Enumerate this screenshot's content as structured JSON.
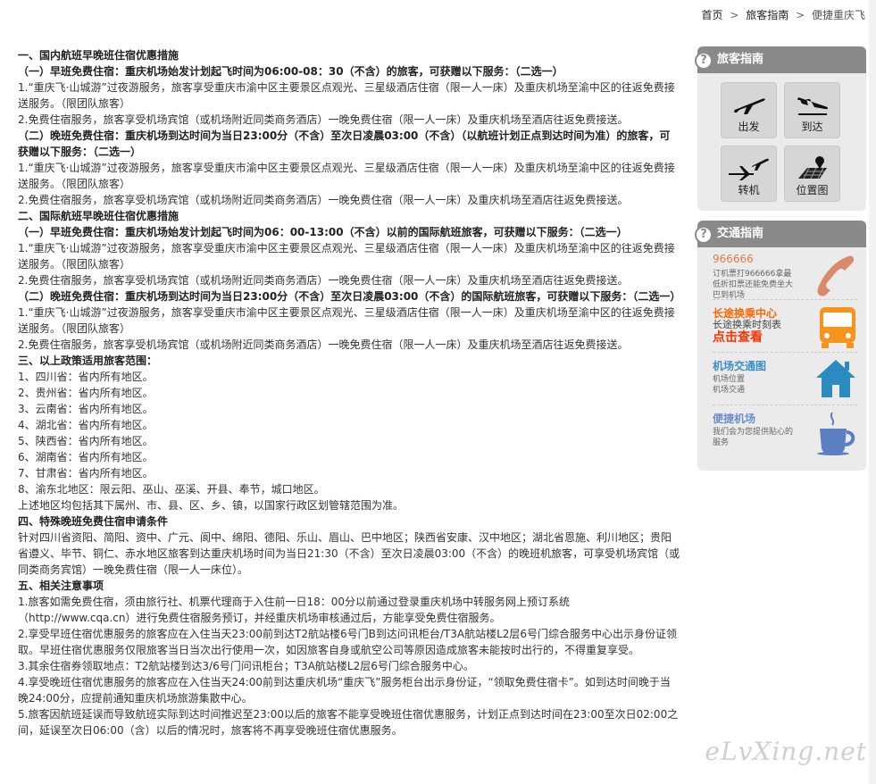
{
  "breadcrumb": {
    "items": [
      "首页",
      "旅客指南",
      "便捷重庆飞"
    ],
    "separator": ">"
  },
  "content": {
    "lines": [
      {
        "text": "一、国内航班早晚班住宿优惠措施",
        "bold": true
      },
      {
        "text": "（一）早班免费住宿：重庆机场始发计划起飞时间为06:00-08：30（不含）的旅客，可获赠以下服务：（二选一）",
        "bold": true
      },
      {
        "text": "1.“重庆飞·山城游”过夜游服务，旅客享受重庆市渝中区主要景区点观光、三星级酒店住宿（限一人一床）及重庆机场至渝中区的往返免费接送服务。（限团队旅客）",
        "bold": false
      },
      {
        "text": "2.免费住宿服务，旅客享受机场宾馆（或机场附近同类商务酒店）一晚免费住宿（限一人一床）及重庆机场至酒店往返免费接送。",
        "bold": false
      },
      {
        "text": "（二）晚班免费住宿：重庆机场到达时间为当日23:00分（不含）至次日凌晨03:00（不含）（以航班计划正点到达时间为准）的旅客，可获赠以下服务：（二选一）",
        "bold": true
      },
      {
        "text": "1.“重庆飞·山城游”过夜游服务，旅客享受重庆市渝中区主要景区点观光、三星级酒店住宿（限一人一床）及重庆机场至渝中区的往返免费接送服务。（限团队旅客）",
        "bold": false
      },
      {
        "text": "2.免费住宿服务，旅客享受机场宾馆（或机场附近同类商务酒店）一晚免费住宿（限一人一床）及重庆机场至酒店往返免费接送。",
        "bold": false
      },
      {
        "text": "二、国际航班早晚班住宿优惠措施",
        "bold": true
      },
      {
        "text": "（一）早班免费住宿：重庆机场始发计划起飞时间为06：00-13:00（不含）以前的国际航班旅客，可获赠以下服务：（二选一）",
        "bold": true
      },
      {
        "text": "1.“重庆飞·山城游”过夜游服务，旅客享受重庆市渝中区主要景区点观光、三星级酒店住宿（限一人一床）及重庆机场至渝中区的往返免费接送服务。（限团队旅客）",
        "bold": false
      },
      {
        "text": "2.免费住宿服务，旅客享受机场宾馆（或机场附近同类商务酒店）一晚免费住宿（限一人一床）及重庆机场至酒店往返免费接送。",
        "bold": false
      },
      {
        "text": "（二）晚班免费住宿：重庆机场到达时间为当日23:00分（不含）至次日凌晨03:00（不含）的国际航班旅客，可获赠以下服务：（二选一）",
        "bold": true
      },
      {
        "text": "1.“重庆飞·山城游”过夜游服务，旅客享受重庆市渝中区主要景区点观光、三星级酒店住宿（限一人一床）及重庆机场至渝中区的往返免费接送服务。（限团队旅客）",
        "bold": false
      },
      {
        "text": "2.免费住宿服务，旅客享受机场宾馆（或机场附近同类商务酒店）一晚免费住宿（限一人一床）及重庆机场至酒店往返免费接送。",
        "bold": false
      },
      {
        "text": "三、以上政策适用旅客范围：",
        "bold": true
      },
      {
        "text": "1、四川省：省内所有地区。",
        "bold": false
      },
      {
        "text": "2、贵州省：省内所有地区。",
        "bold": false
      },
      {
        "text": "3、云南省：省内所有地区。",
        "bold": false
      },
      {
        "text": "4、湖北省：省内所有地区。",
        "bold": false
      },
      {
        "text": "5、陕西省：省内所有地区。",
        "bold": false
      },
      {
        "text": "6、湖南省：省内所有地区。",
        "bold": false
      },
      {
        "text": "7、甘肃省：省内所有地区。",
        "bold": false
      },
      {
        "text": "8、渝东北地区：限云阳、巫山、巫溪、开县、奉节，城口地区。",
        "bold": false
      },
      {
        "text": "上述地区均包括其下属州、市、县、区、乡、镇，以国家行政区划管辖范围为准。",
        "bold": false
      },
      {
        "text": "四、特殊晚班免费住宿申请条件",
        "bold": true
      },
      {
        "text": "针对四川省资阳、简阳、资中、广元、阆中、绵阳、德阳、乐山、眉山、巴中地区；陕西省安康、汉中地区；湖北省恩施、利川地区；贵阳省遵义、毕节、铜仁、赤水地区旅客到达重庆机场时间为当日21:30（不含）至次日凌晨03:00（不含）的晚班机旅客，可享受机场宾馆（或同类商务宾馆）一晚免费住宿（限一人一床位）。",
        "bold": false
      },
      {
        "text": "五、相关注意事项",
        "bold": true
      },
      {
        "text": "1.旅客如需免费住宿，须由旅行社、机票代理商于入住前一日18：00分以前通过登录重庆机场中转服务网上预订系统（http://www.cqa.cn）进行免费住宿服务预订，并经重庆机场审核通过后，方能享受免费住宿服务。",
        "bold": false
      },
      {
        "text": "2.享受早班住宿优惠服务的旅客应在入住当天23:00前到达T2航站楼6号门B到达问讯柜台/T3A航站楼L2层6号门综合服务中心出示身份证领取。早班住宿优惠服务仅限旅客当日当次出行使用一次，如因旅客自身或航空公司等原因造成旅客未能按时出行的，不得重复享受。",
        "bold": false
      },
      {
        "text": "3.其余住宿券领取地点：T2航站楼到达3/6号门问讯柜台；T3A航站楼L2层6号门综合服务中心。",
        "bold": false
      },
      {
        "text": "4.享受晚班住宿优惠服务的旅客应在入住当天24:00前到达重庆机场“重庆飞”服务柜台出示身份证，“领取免费住宿卡”。如到达时间晚于当晚24:00分，应提前通知重庆机场旅游集散中心。",
        "bold": false
      },
      {
        "text": "5.旅客因航班延误而导致航班实际到达时间推迟至23:00以后的旅客不能享受晚班住宿优惠服务，计划正点到达时间在23:00至次日02:00之间，延误至次日06:00（含）以后的情况时，旅客将不再享受晚班住宿优惠服务。",
        "bold": false
      }
    ]
  },
  "sidebar": {
    "guide": {
      "title": "旅客指南",
      "items": [
        {
          "label": "出发",
          "icon": "departure-plane-icon"
        },
        {
          "label": "到达",
          "icon": "arrival-plane-icon"
        },
        {
          "label": "转机",
          "icon": "transfer-planes-icon"
        },
        {
          "label": "位置图",
          "icon": "location-map-icon"
        }
      ]
    },
    "traffic": {
      "title": "交通指南",
      "items": [
        {
          "title": "966666",
          "desc": "订机票打966666拿最低折扣票还能免费坐大巴到机场",
          "title_color": "#e07a4a",
          "icon": "phone-handset-icon"
        },
        {
          "title": "长途换乘中心",
          "desc": "长途换乘时刻表",
          "extra": "点击查看",
          "title_color": "#ff6600",
          "icon": "bus-icon"
        },
        {
          "title": "机场交通图",
          "desc": "机场位置\n机场交通",
          "title_color": "#3a8fc9",
          "icon": "house-icon"
        },
        {
          "title": "便捷机场",
          "desc": "我们会为您提供贴心的服务",
          "title_color": "#6b8fc8",
          "icon": "coffee-cup-icon"
        }
      ]
    }
  },
  "watermark": "eLvXing.net"
}
